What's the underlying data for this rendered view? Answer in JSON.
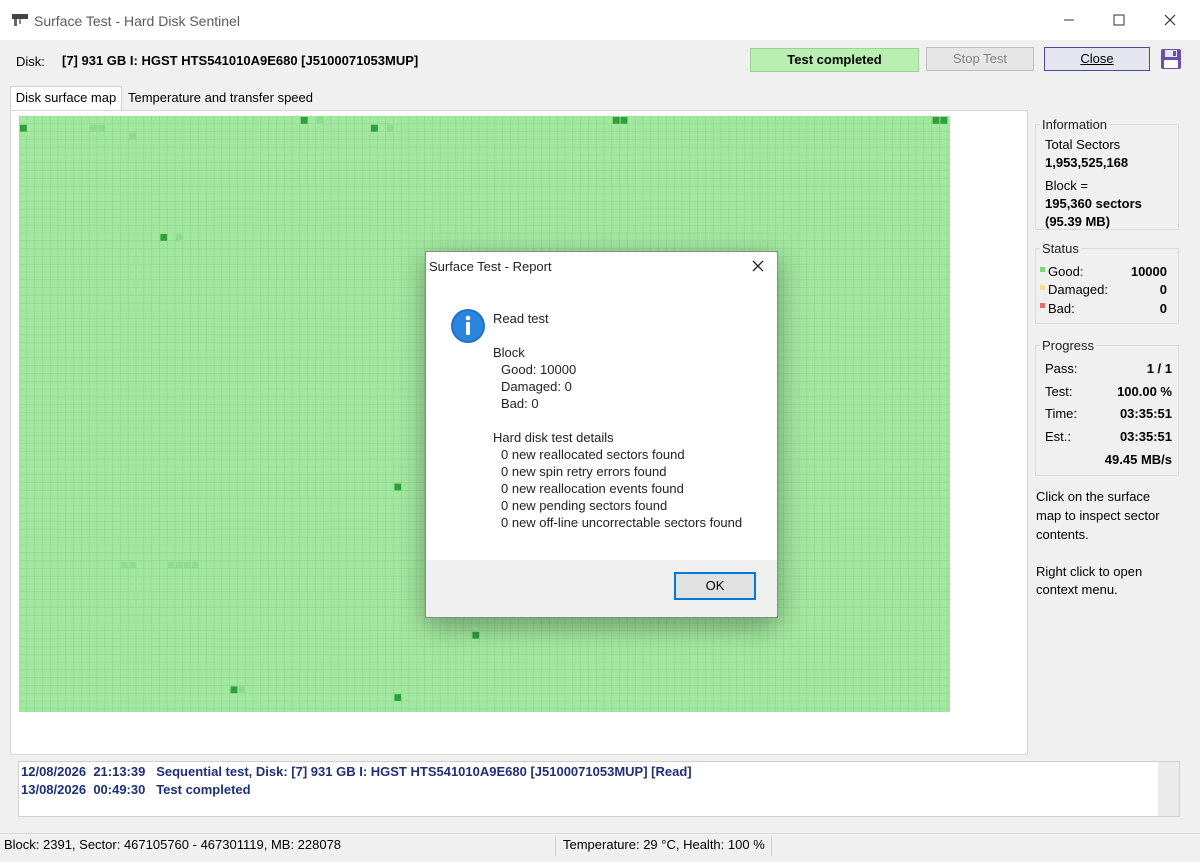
{
  "window": {
    "title": "Surface Test - Hard Disk Sentinel",
    "minimize_label": "—",
    "maximize_label": "☐",
    "close_label": "✕"
  },
  "header": {
    "disk_label": "Disk:",
    "disk_value": "[7] 931 GB I: HGST HTS541010A9E680 [J5100071053MUP]",
    "test_status": "Test completed",
    "stop_test_label": "Stop Test",
    "close_label": "Close",
    "save_icon": "floppy-disk-icon"
  },
  "tabs": [
    {
      "label": "Disk surface map",
      "active": true
    },
    {
      "label": "Temperature and transfer speed",
      "active": false
    }
  ],
  "surface_map": {
    "cell_color_good": "#a3e8a0",
    "cell_color_highlight": "#2ea03a",
    "grid_color": "#8fd48c"
  },
  "information": {
    "title": "Information",
    "total_sectors_label": "Total Sectors",
    "total_sectors_value": "1,953,525,168",
    "block_label": "Block =",
    "block_sectors": "195,360 sectors",
    "block_mb": "(95.39 MB)"
  },
  "status": {
    "title": "Status",
    "good_label": "Good:",
    "good_value": "10000",
    "damaged_label": "Damaged:",
    "damaged_value": "0",
    "bad_label": "Bad:",
    "bad_value": "0",
    "good_color": "#7fd67a",
    "damaged_color": "#f3e28c",
    "bad_color": "#e07070"
  },
  "progress": {
    "title": "Progress",
    "pass_label": "Pass:",
    "pass_value": "1 / 1",
    "test_label": "Test:",
    "test_value": "100.00 %",
    "time_label": "Time:",
    "time_value": "03:35:51",
    "est_label": "Est.:",
    "est_value": "03:35:51",
    "speed_value": "49.45 MB/s"
  },
  "hints": {
    "click_hint_1": "Click on the surface",
    "click_hint_2": "map to inspect sector",
    "click_hint_3": "contents.",
    "right_click_1": "Right click to open",
    "right_click_2": "context menu."
  },
  "dialog": {
    "title": "Surface Test - Report",
    "icon": "info-icon",
    "heading": "Read test",
    "block_label": "Block",
    "good_line": "Good: 10000",
    "damaged_line": "Damaged: 0",
    "bad_line": "Bad: 0",
    "details_label": "Hard disk test details",
    "details": [
      "0 new reallocated sectors found",
      "0 new spin retry errors found",
      "0 new reallocation events found",
      "0 new pending sectors found",
      "0 new off-line uncorrectable sectors found"
    ],
    "ok_label": "OK"
  },
  "log": [
    {
      "date": "12/08/2026",
      "time": "21:13:39",
      "message": "Sequential test, Disk: [7] 931 GB I: HGST HTS541010A9E680 [J5100071053MUP] [Read]"
    },
    {
      "date": "13/08/2026",
      "time": "00:49:30",
      "message": "Test completed"
    }
  ],
  "statusbar": {
    "block_info": "Block: 2391, Sector: 467105760 - 467301119, MB: 228078",
    "temperature_health": "Temperature: 29  °C, Health: 100 %"
  }
}
